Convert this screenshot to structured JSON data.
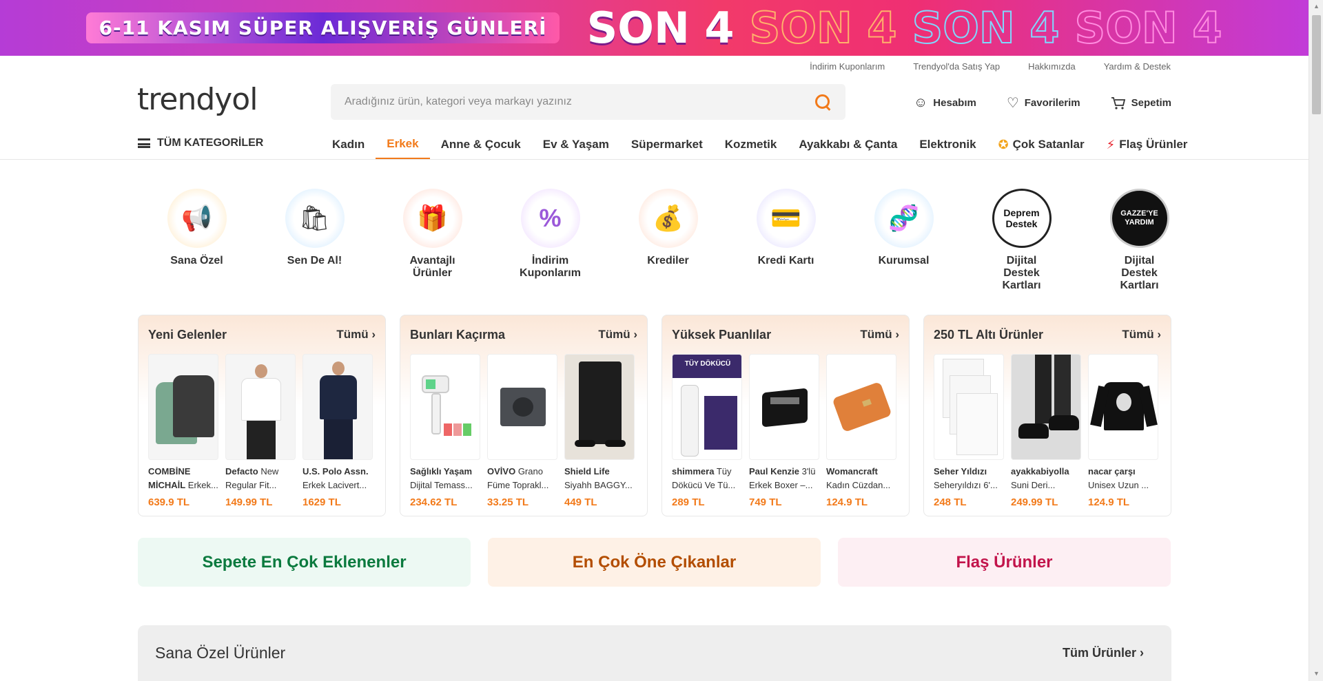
{
  "promo": {
    "left_text": "6-11 KASIM SÜPER ALIŞVERİŞ GÜNLERİ",
    "son_text": "SON 4"
  },
  "util_links": [
    "İndirim Kuponlarım",
    "Trendyol'da Satış Yap",
    "Hakkımızda",
    "Yardım & Destek"
  ],
  "header": {
    "logo": "trendyol",
    "search_placeholder": "Aradığınız ürün, kategori veya markayı yazınız",
    "account": "Hesabım",
    "favorites": "Favorilerim",
    "cart": "Sepetim"
  },
  "category_nav": {
    "all": "TÜM KATEGORİLER",
    "items": [
      "Kadın",
      "Erkek",
      "Anne & Çocuk",
      "Ev & Yaşam",
      "Süpermarket",
      "Kozmetik",
      "Ayakkabı & Çanta",
      "Elektronik",
      "Çok Satanlar",
      "Flaş Ürünler"
    ],
    "active": "Erkek"
  },
  "quick_links": [
    {
      "label": "Sana Özel",
      "icon": "megaphone-icon"
    },
    {
      "label": "Sen De Al!",
      "icon": "shopping-bags-icon"
    },
    {
      "label": "Avantajlı Ürünler",
      "icon": "gift-box-icon"
    },
    {
      "label": "İndirim Kuponlarım",
      "icon": "coupon-icon"
    },
    {
      "label": "Krediler",
      "icon": "money-bag-icon"
    },
    {
      "label": "Kredi Kartı",
      "icon": "credit-card-icon"
    },
    {
      "label": "Kurumsal",
      "icon": "corporate-products-icon"
    },
    {
      "label": "Dijital Destek Kartları",
      "icon": "deprem-destek-logo",
      "circle_text": "Deprem Destek"
    },
    {
      "label": "Dijital Destek Kartları",
      "icon": "gazzeye-yardim-logo",
      "circle_text": "GAZZE'YE YARDIM"
    }
  ],
  "panels": [
    {
      "title": "Yeni Gelenler",
      "all": "Tümü",
      "products": [
        {
          "brand": "COMBİNE MİCHAİL",
          "name": "Erkek...",
          "price": "639.9 TL"
        },
        {
          "brand": "Defacto",
          "name": "New Regular Fit...",
          "price": "149.99 TL"
        },
        {
          "brand": "U.S. Polo Assn.",
          "name": "Erkek Lacivert...",
          "price": "1629 TL"
        }
      ]
    },
    {
      "title": "Bunları Kaçırma",
      "all": "Tümü",
      "products": [
        {
          "brand": "Sağlıklı Yaşam",
          "name": "Dijital Temass...",
          "price": "234.62 TL"
        },
        {
          "brand": "OVİVO",
          "name": "Grano Füme Toprakl...",
          "price": "33.25 TL"
        },
        {
          "brand": "Shield Life",
          "name": "Siyahh BAGGY...",
          "price": "449 TL"
        }
      ]
    },
    {
      "title": "Yüksek Puanlılar",
      "all": "Tümü",
      "products": [
        {
          "brand": "shimmera",
          "name": "Tüy Dökücü Ve Tü...",
          "price": "289 TL",
          "img_text": "TÜY DÖKÜCÜ"
        },
        {
          "brand": "Paul Kenzie",
          "name": "3'lü Erkek Boxer –...",
          "price": "749 TL"
        },
        {
          "brand": "Womancraft",
          "name": "Kadın Cüzdan...",
          "price": "124.9 TL"
        }
      ]
    },
    {
      "title": "250 TL Altı Ürünler",
      "all": "Tümü",
      "products": [
        {
          "brand": "Seher Yıldızı",
          "name": "Seheryıldızı 6'...",
          "price": "248 TL"
        },
        {
          "brand": "ayakkabiyolla",
          "name": "Suni Deri...",
          "price": "249.99 TL"
        },
        {
          "brand": "nacar çarşı",
          "name": "Unisex Uzun ...",
          "price": "124.9 TL"
        }
      ]
    }
  ],
  "action_buttons": [
    "Sepete En Çok Eklenenler",
    "En Çok Öne Çıkanlar",
    "Flaş Ürünler"
  ],
  "special_section": {
    "title": "Sana Özel Ürünler",
    "all": "Tüm Ürünler"
  },
  "colors": {
    "brand_orange": "#f27a1a"
  }
}
